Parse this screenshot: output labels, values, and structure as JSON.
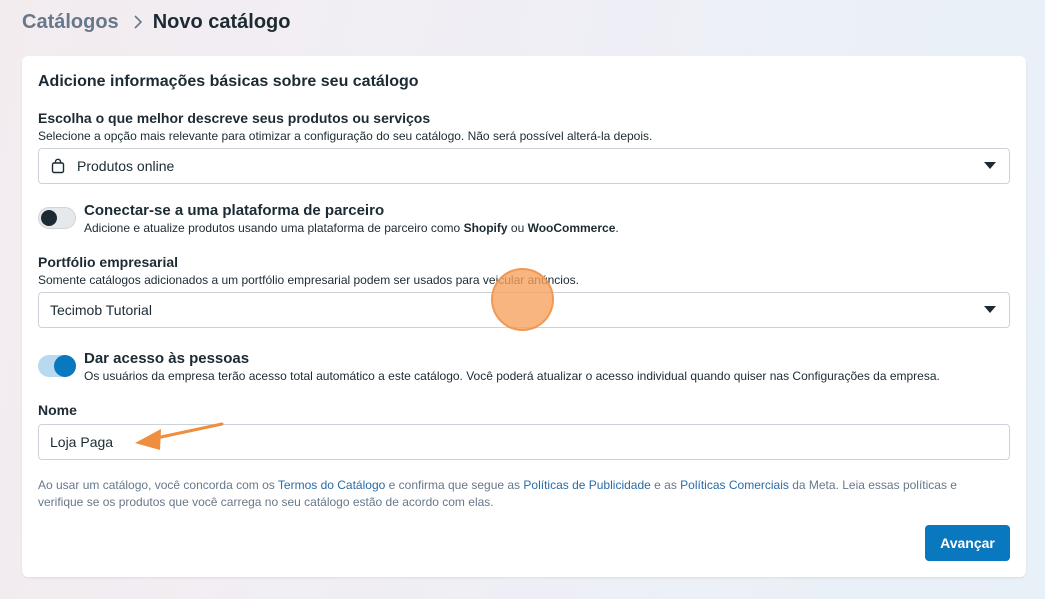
{
  "breadcrumb": {
    "parent": "Catálogos",
    "current": "Novo catálogo"
  },
  "card": {
    "title": "Adicione informações básicas sobre seu catálogo",
    "product_type": {
      "label": "Escolha o que melhor descreve seus produtos ou serviços",
      "help": "Selecione a opção mais relevante para otimizar a configuração do seu catálogo. Não será possível alterá-la depois.",
      "value": "Produtos online",
      "icon": "shopping-bag-icon"
    },
    "partner": {
      "title": "Conectar-se a uma plataforma de parceiro",
      "text_before": "Adicione e atualize produtos usando uma plataforma de parceiro como ",
      "shopify": "Shopify",
      "text_mid": " ou ",
      "woocommerce": "WooCommerce",
      "text_after": ".",
      "enabled": false
    },
    "portfolio": {
      "label": "Portfólio empresarial",
      "help": "Somente catálogos adicionados a um portfólio empresarial podem ser usados para veicular anúncios.",
      "value": "Tecimob Tutorial"
    },
    "access": {
      "title": "Dar acesso às pessoas",
      "text": "Os usuários da empresa terão acesso total automático a este catálogo. Você poderá atualizar o acesso individual quando quiser nas Configurações da empresa.",
      "enabled": true
    },
    "name": {
      "label": "Nome",
      "value": "Loja Paga"
    },
    "terms": {
      "t1": "Ao usar um catálogo, você concorda com os ",
      "link1": "Termos do Catálogo",
      "t2": " e confirma que segue as ",
      "link2": "Políticas de Publicidade",
      "t3": " e as ",
      "link3": "Políticas Comerciais",
      "t4": " da Meta. Leia essas políticas e verifique se os produtos que você carrega no seu catálogo estão de acordo com elas."
    },
    "next_button": "Avançar"
  },
  "colors": {
    "accent": "#0a78be",
    "marker": "#f7a05c",
    "link": "#2a6ba8"
  }
}
